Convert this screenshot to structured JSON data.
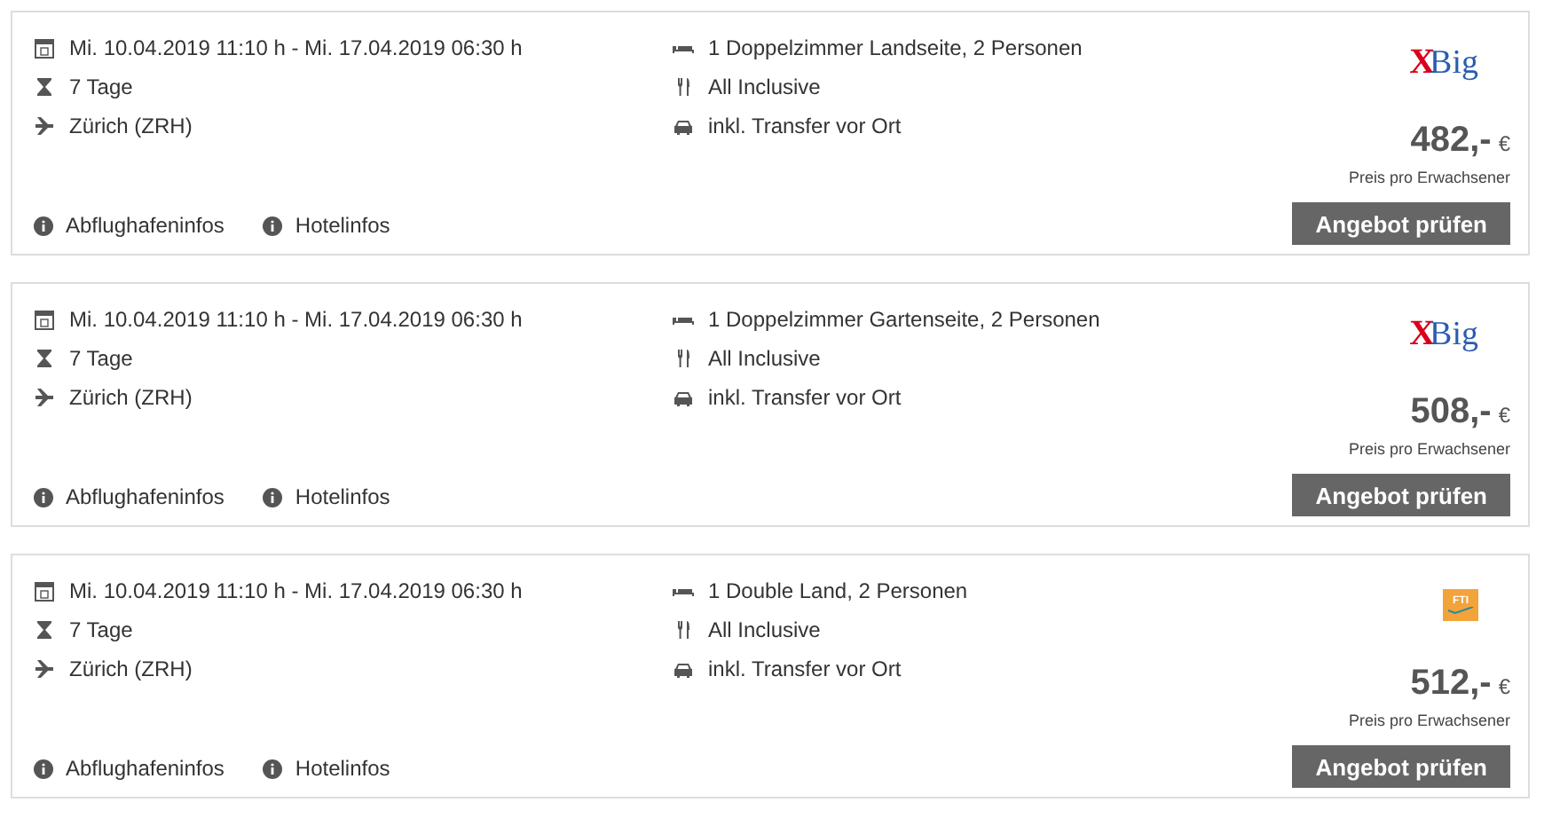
{
  "offers": [
    {
      "dates": "Mi. 10.04.2019 11:10 h - Mi. 17.04.2019 06:30 h",
      "duration": "7 Tage",
      "airport": "Zürich (ZRH)",
      "room": "1 Doppelzimmer Landseite, 2 Personen",
      "board": "All Inclusive",
      "transfer": "inkl. Transfer vor Ort",
      "operator": {
        "kind": "xbig",
        "mark": "X",
        "name": "Big"
      },
      "price": "482,-",
      "currency": "€",
      "price_note": "Preis pro Erwachsener",
      "button": "Angebot prüfen",
      "links": [
        "Abflughafeninfos",
        "Hotelinfos"
      ]
    },
    {
      "dates": "Mi. 10.04.2019 11:10 h - Mi. 17.04.2019 06:30 h",
      "duration": "7 Tage",
      "airport": "Zürich (ZRH)",
      "room": "1 Doppelzimmer Gartenseite, 2 Personen",
      "board": "All Inclusive",
      "transfer": "inkl. Transfer vor Ort",
      "operator": {
        "kind": "xbig",
        "mark": "X",
        "name": "Big"
      },
      "price": "508,-",
      "currency": "€",
      "price_note": "Preis pro Erwachsener",
      "button": "Angebot prüfen",
      "links": [
        "Abflughafeninfos",
        "Hotelinfos"
      ]
    },
    {
      "dates": "Mi. 10.04.2019 11:10 h - Mi. 17.04.2019 06:30 h",
      "duration": "7 Tage",
      "airport": "Zürich (ZRH)",
      "room": "1 Double Land, 2 Personen",
      "board": "All Inclusive",
      "transfer": "inkl. Transfer vor Ort",
      "operator": {
        "kind": "fti",
        "name": "FTI"
      },
      "price": "512,-",
      "currency": "€",
      "price_note": "Preis pro Erwachsener",
      "button": "Angebot prüfen",
      "links": [
        "Abflughafeninfos",
        "Hotelinfos"
      ]
    }
  ]
}
